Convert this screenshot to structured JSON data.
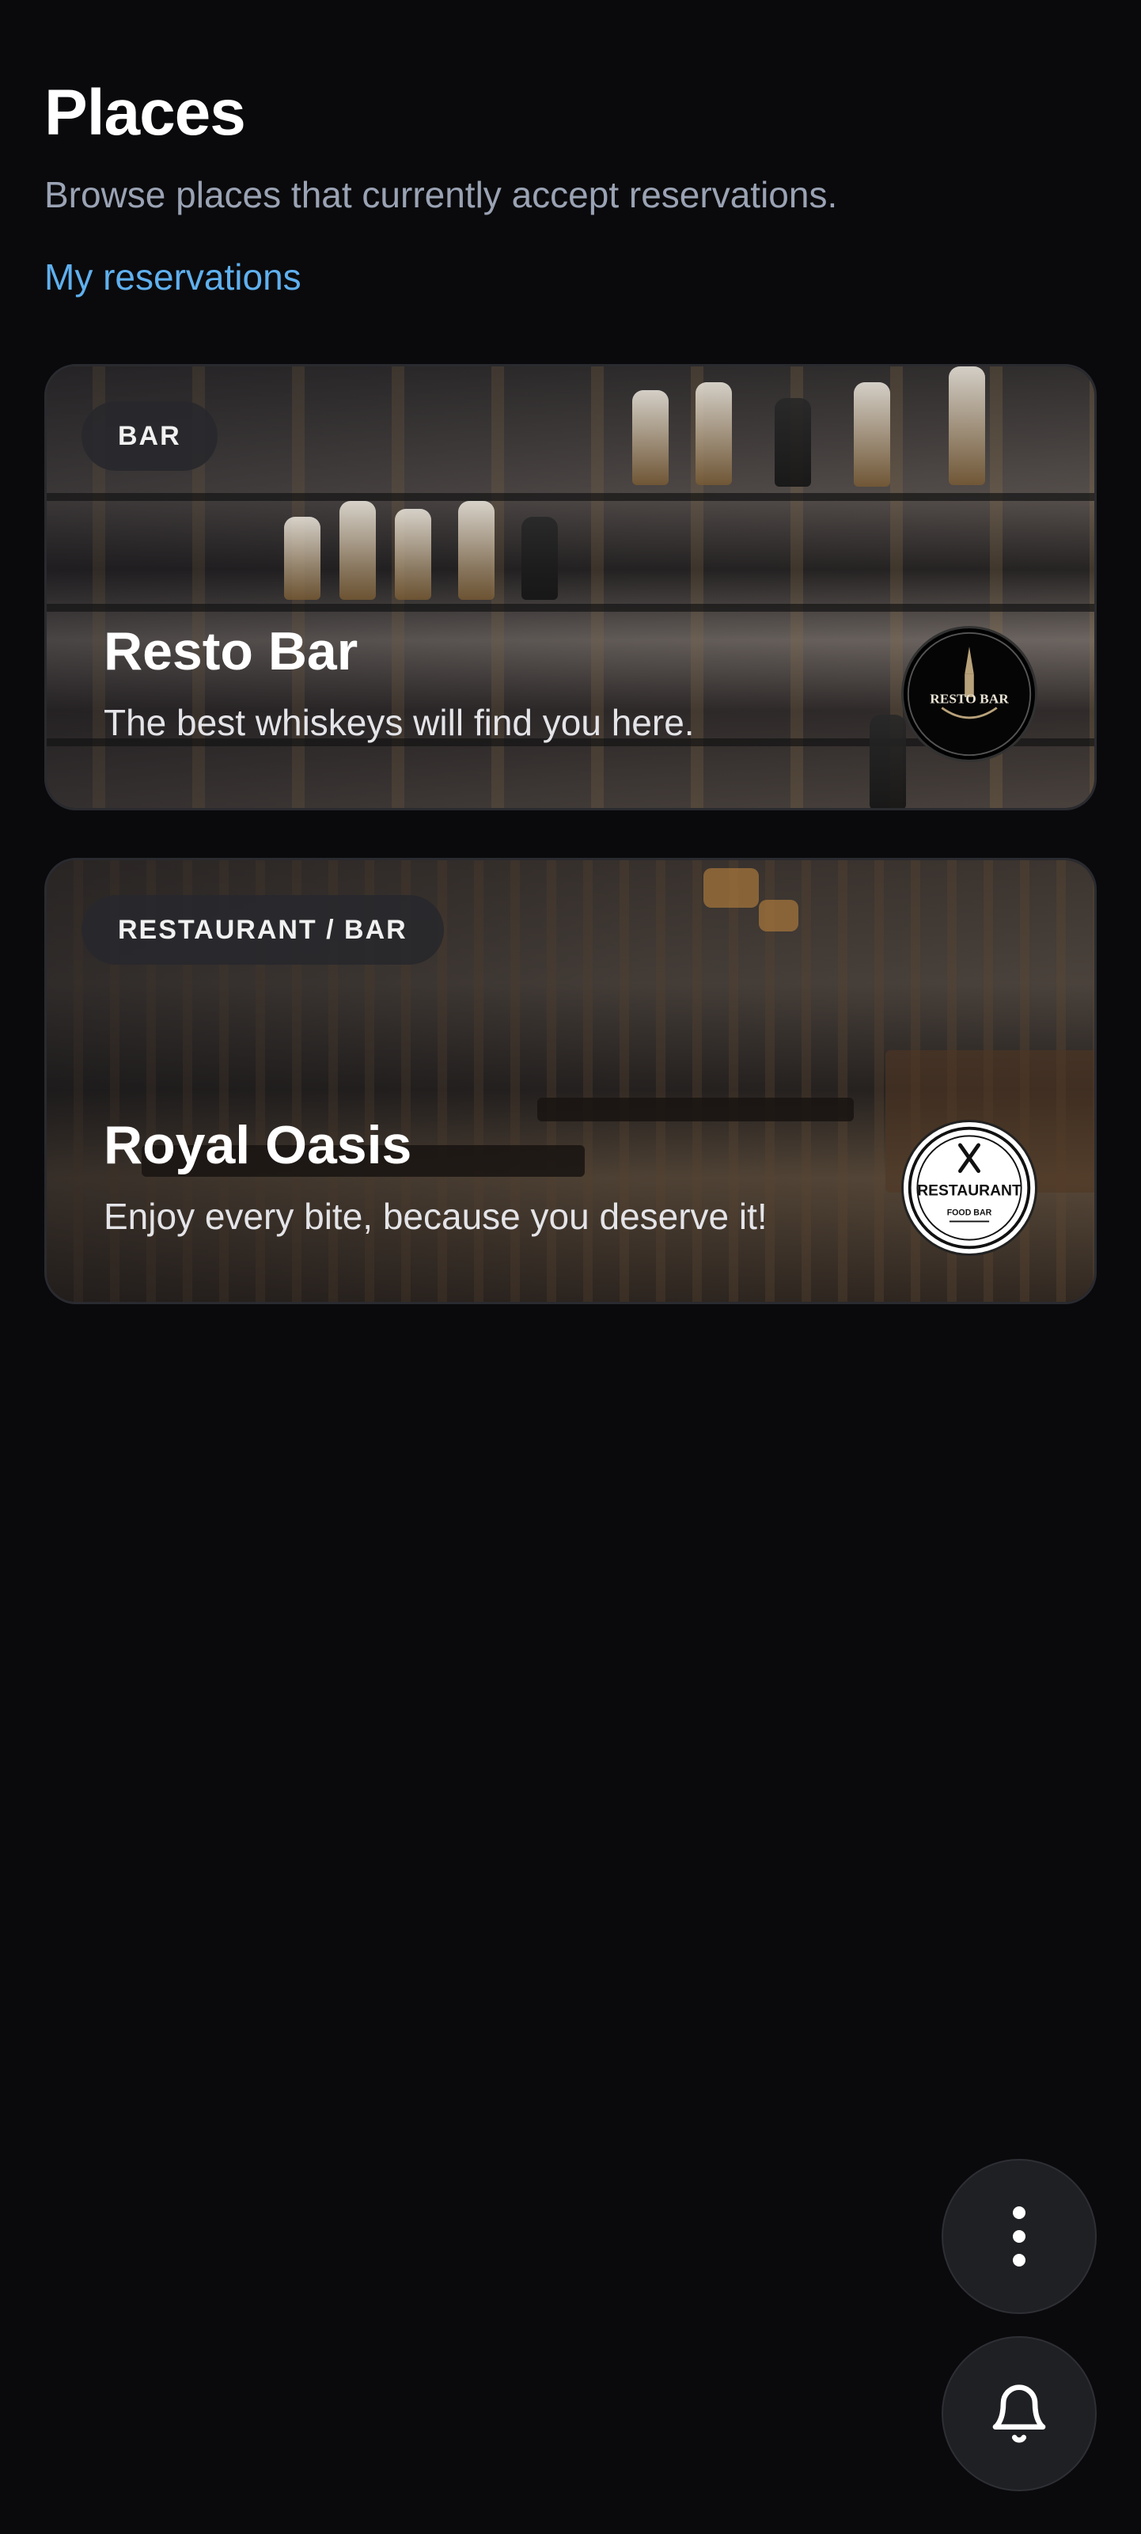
{
  "header": {
    "title": "Places",
    "subtitle": "Browse places that currently accept reservations.",
    "my_reservations_link": "My reservations"
  },
  "places": [
    {
      "category": "BAR",
      "name": "Resto Bar",
      "description": "The best whiskeys will find you here.",
      "logo_icon": "resto-bar-logo",
      "logo_text": "RESTO BAR"
    },
    {
      "category": "RESTAURANT / BAR",
      "name": "Royal Oasis",
      "description": "Enjoy every bite, because you deserve it!",
      "logo_icon": "restaurant-food-bar-logo",
      "logo_text": "RESTAURANT",
      "logo_subtext": "FOOD BAR"
    }
  ],
  "fabs": {
    "menu_icon": "more-vertical-icon",
    "notifications_icon": "bell-icon"
  },
  "colors": {
    "background": "#0a0a0c",
    "link": "#5fb0ee",
    "subtitle": "#9aa3b4",
    "badge_bg": "#28282c",
    "fab_bg": "#1f2024"
  }
}
